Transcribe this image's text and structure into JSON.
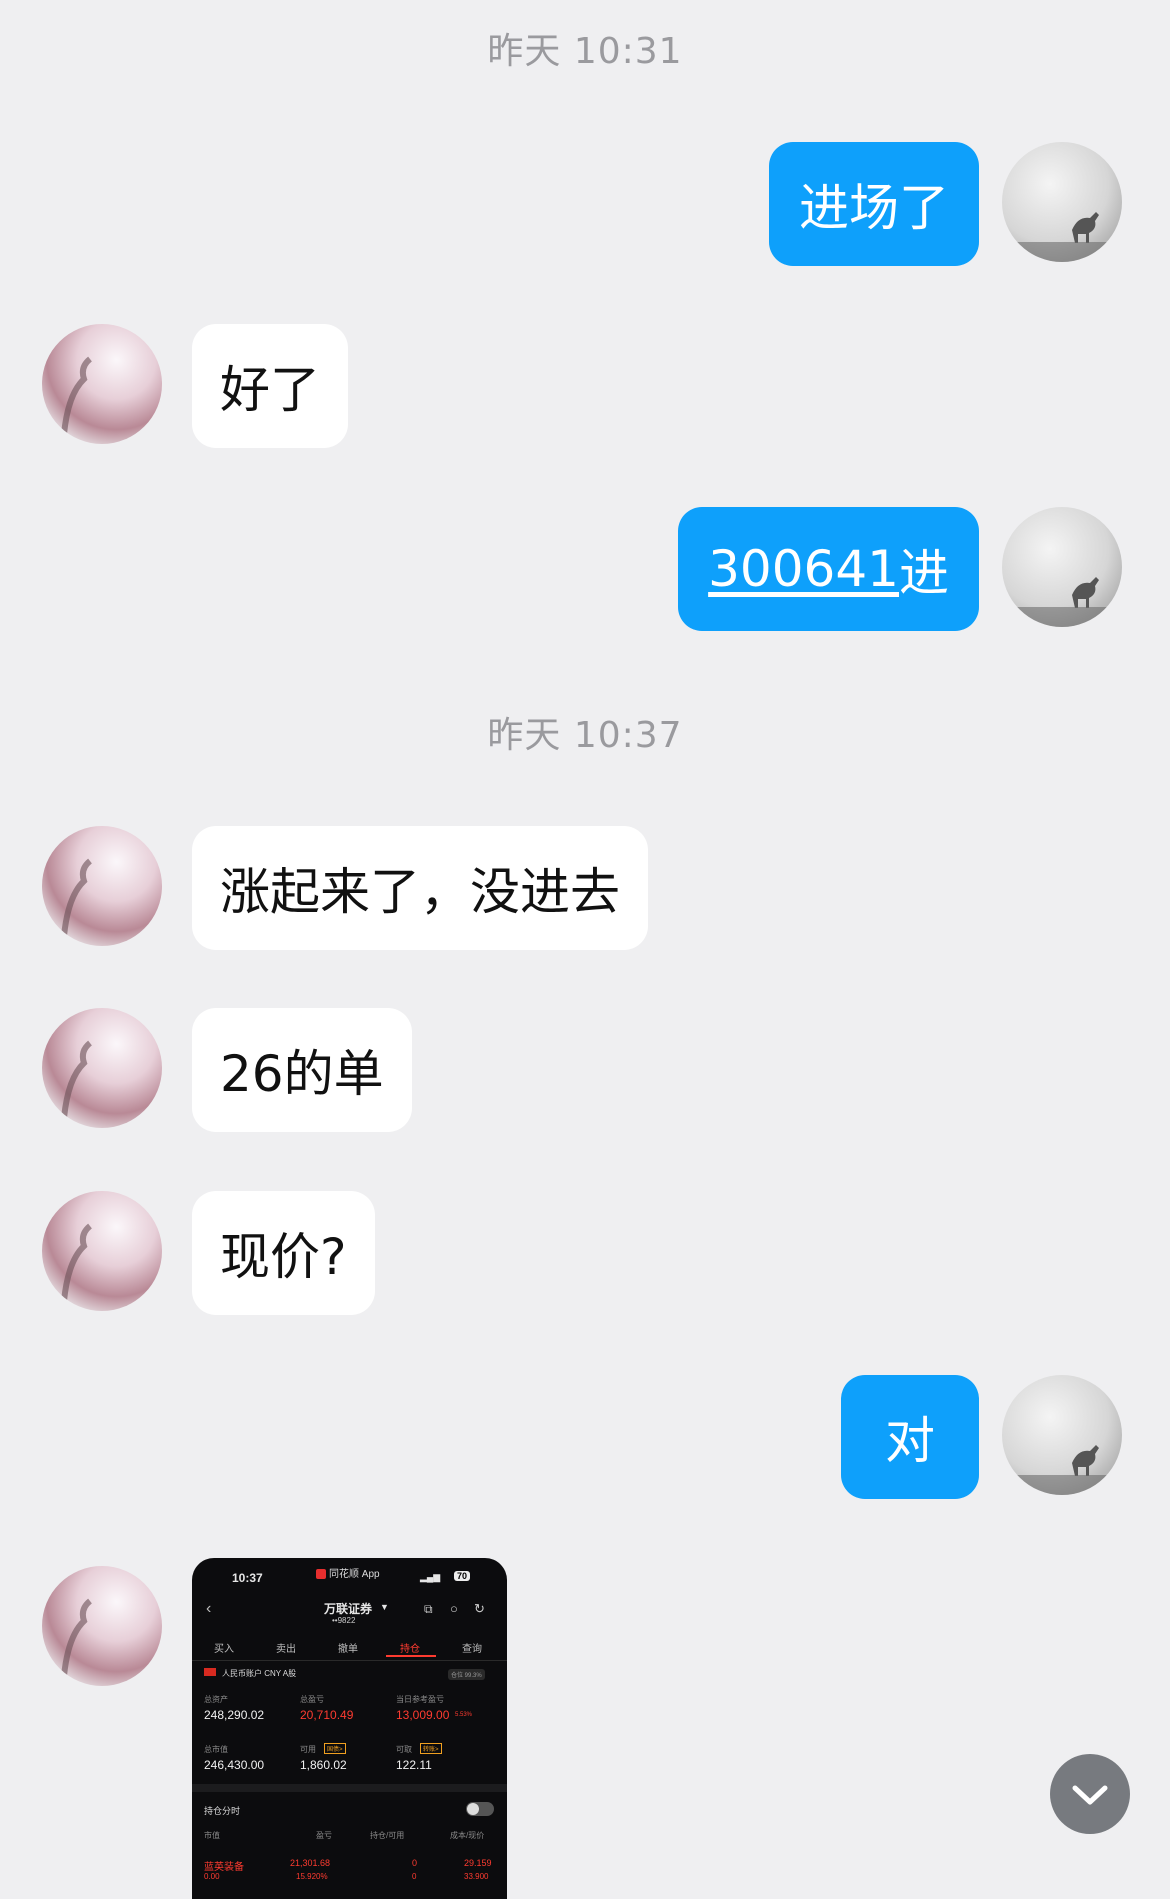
{
  "timestamps": [
    "昨天 10:31",
    "昨天 10:37"
  ],
  "messages": [
    {
      "from": "me",
      "text": "进场了"
    },
    {
      "from": "peer",
      "text": "好了"
    },
    {
      "from": "me",
      "text": "300641进",
      "link_part": "300641",
      "rest": "进"
    },
    {
      "from": "peer",
      "text": "涨起来了，没进去"
    },
    {
      "from": "peer",
      "text": "26的单"
    },
    {
      "from": "peer",
      "text": "现价?"
    },
    {
      "from": "me",
      "text": "对"
    }
  ],
  "image_message": {
    "time": "10:37",
    "app_name": "同花顺 App",
    "battery": "70",
    "broker": "万联证券",
    "account": "••9822",
    "tabs": [
      "买入",
      "卖出",
      "撤单",
      "持仓",
      "查询"
    ],
    "active_tab": "持仓",
    "account_type": "人民币账户 CNY A股",
    "position_ratio": "仓位 99.3%",
    "total_assets_label": "总资产",
    "total_assets": "248,290.02",
    "total_pnl_label": "总盈亏",
    "total_pnl": "20,710.49",
    "today_pnl_label": "当日参考盈亏",
    "today_pnl": "13,009.00",
    "today_pnl_pct": "5.53%",
    "market_value_label": "总市值",
    "market_value": "246,430.00",
    "available_label": "可用",
    "available_tag": "国债>",
    "available": "1,860.02",
    "withdrawable_label": "可取",
    "withdrawable_tag": "转账>",
    "withdrawable": "122.11",
    "position_timing": "持仓分时",
    "col_market_value": "市值",
    "col_pnl": "盈亏",
    "col_hold": "持仓/可用",
    "col_cost": "成本/现价",
    "stock_name": "蓝英装备",
    "stock_mv": "0.00",
    "stock_pnl": "21,301.68",
    "stock_pnl_pct": "15.920%",
    "stock_hold": "0",
    "stock_avail": "0",
    "stock_cost": "29.159",
    "stock_price": "33.900"
  },
  "colors": {
    "outgoing_bubble": "#0ea0fb",
    "incoming_bubble": "#ffffff",
    "background": "#efeff1",
    "timestamp": "#9a9a9e"
  },
  "icons": {
    "scroll_down": "chevron-down-icon"
  }
}
